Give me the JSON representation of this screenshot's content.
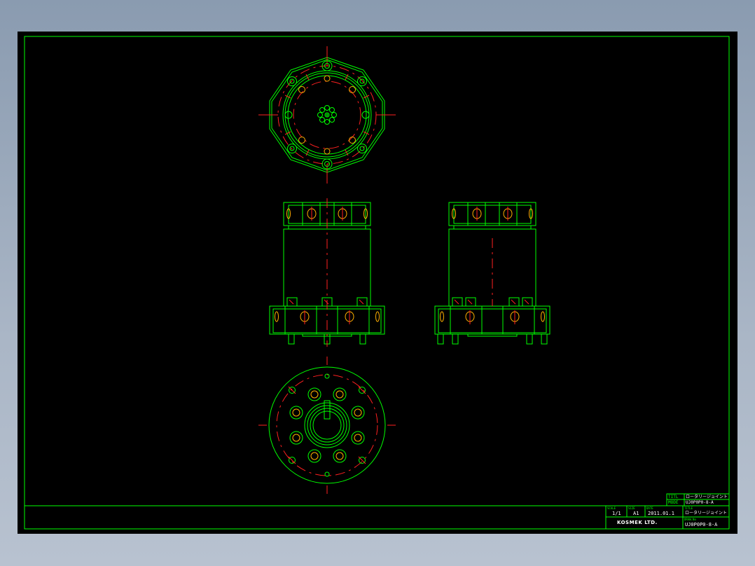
{
  "colors": {
    "sheet": "#000000",
    "outline": "#00ff00",
    "centerline": "#ff2020",
    "hole": "#ffb000",
    "background": "#8a9bb0"
  },
  "title_block": {
    "title_label": "TITL",
    "title_value": "ロータリージョイント",
    "model_label": "MODE",
    "model_value": "UJ0P0P0-8-A",
    "scale_label": "SCALE",
    "scale_value": "1/1",
    "size_label": "SIZE",
    "size_value": "A1",
    "date_label": "DATE",
    "date_value": "2011.01.1",
    "title2_label": "TITLE",
    "title2_value": "ロータリージョイント",
    "drawno_label": "DRAW.No",
    "drawno_value": "UJ0P0P0-8-A",
    "company": "KOSMEK LTD."
  }
}
